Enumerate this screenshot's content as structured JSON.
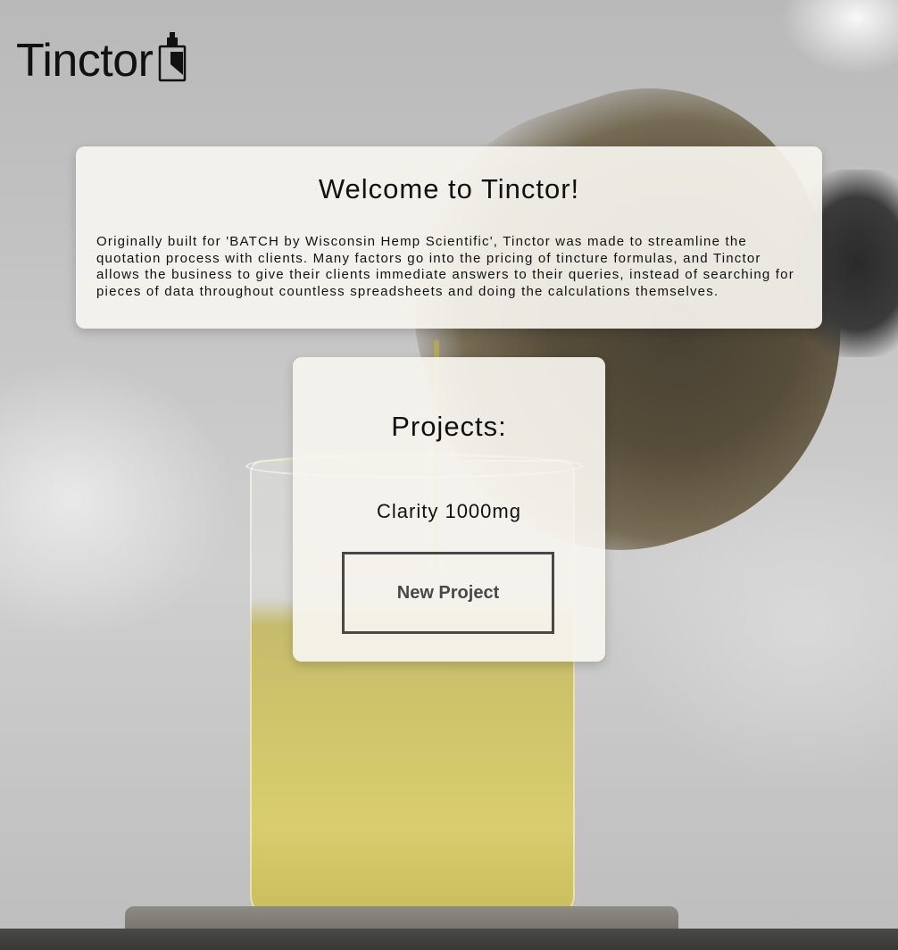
{
  "brand": {
    "name": "Tinctor",
    "icon": "dropper-bottle-icon"
  },
  "welcome": {
    "title": "Welcome to Tinctor!",
    "text": "Originally built for 'BATCH by Wisconsin Hemp Scientific', Tinctor was made to streamline the quotation process with clients. Many factors go into the pricing of tincture formulas, and Tinctor allows the business to give their clients immediate answers to their queries, instead of searching for pieces of data throughout countless spreadsheets and doing the calculations themselves."
  },
  "projects": {
    "title": "Projects:",
    "items": [
      {
        "label": "Clarity 1000mg"
      }
    ],
    "new_button_label": "New Project"
  },
  "colors": {
    "card_background": "#f6f4ee",
    "text": "#111111",
    "button_border": "#4a4845"
  }
}
